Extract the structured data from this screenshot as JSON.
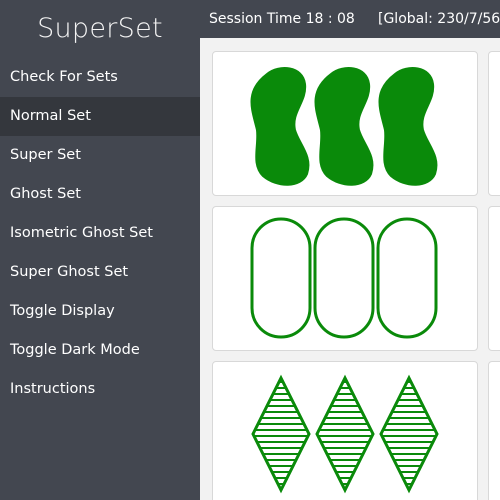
{
  "app": {
    "title": "SuperSet"
  },
  "sidebar": {
    "items": [
      {
        "label": "Check For Sets",
        "name": "sidebar-item-check-for-sets",
        "active": false
      },
      {
        "label": "Normal Set",
        "name": "sidebar-item-normal-set",
        "active": true
      },
      {
        "label": "Super Set",
        "name": "sidebar-item-super-set",
        "active": false
      },
      {
        "label": "Ghost Set",
        "name": "sidebar-item-ghost-set",
        "active": false
      },
      {
        "label": "Isometric Ghost Set",
        "name": "sidebar-item-isometric-ghost-set",
        "active": false
      },
      {
        "label": "Super Ghost Set",
        "name": "sidebar-item-super-ghost-set",
        "active": false
      },
      {
        "label": "Toggle Display",
        "name": "sidebar-item-toggle-display",
        "active": false
      },
      {
        "label": "Toggle Dark Mode",
        "name": "sidebar-item-toggle-dark-mode",
        "active": false
      },
      {
        "label": "Instructions",
        "name": "sidebar-item-instructions",
        "active": false
      }
    ]
  },
  "header": {
    "session_time": "Session Time 18 : 08",
    "global": "[Global: 230/7/56"
  },
  "colors": {
    "sidebar_bg": "#434750",
    "sidebar_active_bg": "#34373d",
    "card_green": "#0a8a0a"
  },
  "cards": [
    {
      "shape": "squiggle",
      "fill": "solid",
      "count": 3,
      "color": "green"
    },
    {
      "shape": "oval",
      "fill": "empty",
      "count": 3,
      "color": "green"
    },
    {
      "shape": "diamond",
      "fill": "striped",
      "count": 3,
      "color": "green"
    }
  ]
}
